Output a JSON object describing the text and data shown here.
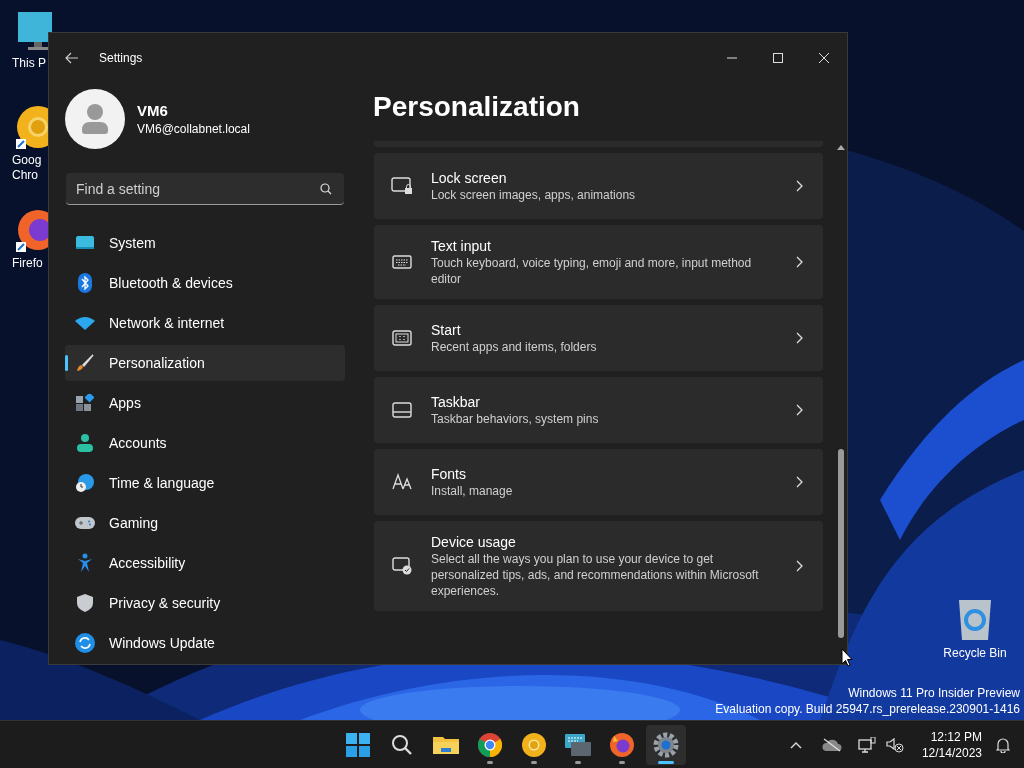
{
  "desktop_icons": [
    {
      "lines": [
        "This P"
      ]
    },
    {
      "lines": [
        "Goog",
        "Chro"
      ]
    },
    {
      "lines": [
        "Firefo"
      ]
    },
    {
      "lines": [
        "Recycle Bin"
      ]
    }
  ],
  "window": {
    "title": "Settings",
    "user": {
      "name": "VM6",
      "email": "VM6@collabnet.local"
    },
    "search": {
      "placeholder": "Find a setting"
    },
    "nav": [
      {
        "label": "System",
        "selected": false
      },
      {
        "label": "Bluetooth & devices",
        "selected": false
      },
      {
        "label": "Network & internet",
        "selected": false
      },
      {
        "label": "Personalization",
        "selected": true
      },
      {
        "label": "Apps",
        "selected": false
      },
      {
        "label": "Accounts",
        "selected": false
      },
      {
        "label": "Time & language",
        "selected": false
      },
      {
        "label": "Gaming",
        "selected": false
      },
      {
        "label": "Accessibility",
        "selected": false
      },
      {
        "label": "Privacy & security",
        "selected": false
      },
      {
        "label": "Windows Update",
        "selected": false
      }
    ],
    "page_title": "Personalization",
    "cards": [
      {
        "title": "Lock screen",
        "description": "Lock screen images, apps, animations"
      },
      {
        "title": "Text input",
        "description": "Touch keyboard, voice typing, emoji and more, input method editor"
      },
      {
        "title": "Start",
        "description": "Recent apps and items, folders"
      },
      {
        "title": "Taskbar",
        "description": "Taskbar behaviors, system pins"
      },
      {
        "title": "Fonts",
        "description": "Install, manage"
      },
      {
        "title": "Device usage",
        "description": "Select all the ways you plan to use your device to get personalized tips, ads, and recommendations within Microsoft experiences."
      }
    ]
  },
  "watermark": [
    "Windows 11 Pro Insider Preview",
    "Evaluation copy. Build 25947.rs_prerelease.230901-1416"
  ],
  "taskbar": {
    "apps": [
      {
        "running": false,
        "selected": false
      },
      {
        "running": false,
        "selected": false
      },
      {
        "running": false,
        "selected": false
      },
      {
        "running": true,
        "selected": false
      },
      {
        "running": true,
        "selected": false
      },
      {
        "running": true,
        "selected": false
      },
      {
        "running": true,
        "selected": false
      },
      {
        "running": true,
        "selected": true
      }
    ],
    "time": "12:12 PM",
    "date": "12/14/2023"
  }
}
